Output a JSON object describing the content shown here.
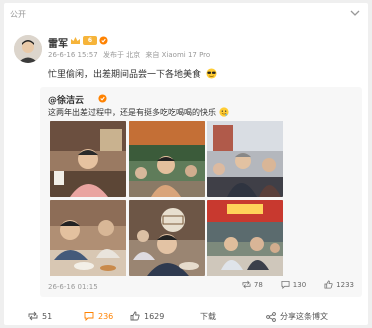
{
  "post": {
    "visibility": "公开",
    "author": "雷军",
    "vip_level": "6",
    "timestamp": "26-6-16 15:57",
    "published": "发布于 北京",
    "source": "来自 Xiaomi 17 Pro",
    "text": "忙里偷闲，出差期间品尝一下各地美食"
  },
  "repost": {
    "author": "@徐洁云",
    "text": "这两年出差过程中，还是有挺多吃吃喝喝的快乐",
    "date": "26-6-16 01:15",
    "share_count": "78",
    "comment_count": "130",
    "like_count": "1233"
  },
  "actions": {
    "share_count": "51",
    "comment_count": "236",
    "like_count": "1629",
    "download_label": "下载",
    "share_label": "分享这条博文"
  },
  "colors": {
    "accent": "#ff8200",
    "vip": "#f6b43a",
    "verify": "#ff8200",
    "muted": "#999999"
  }
}
